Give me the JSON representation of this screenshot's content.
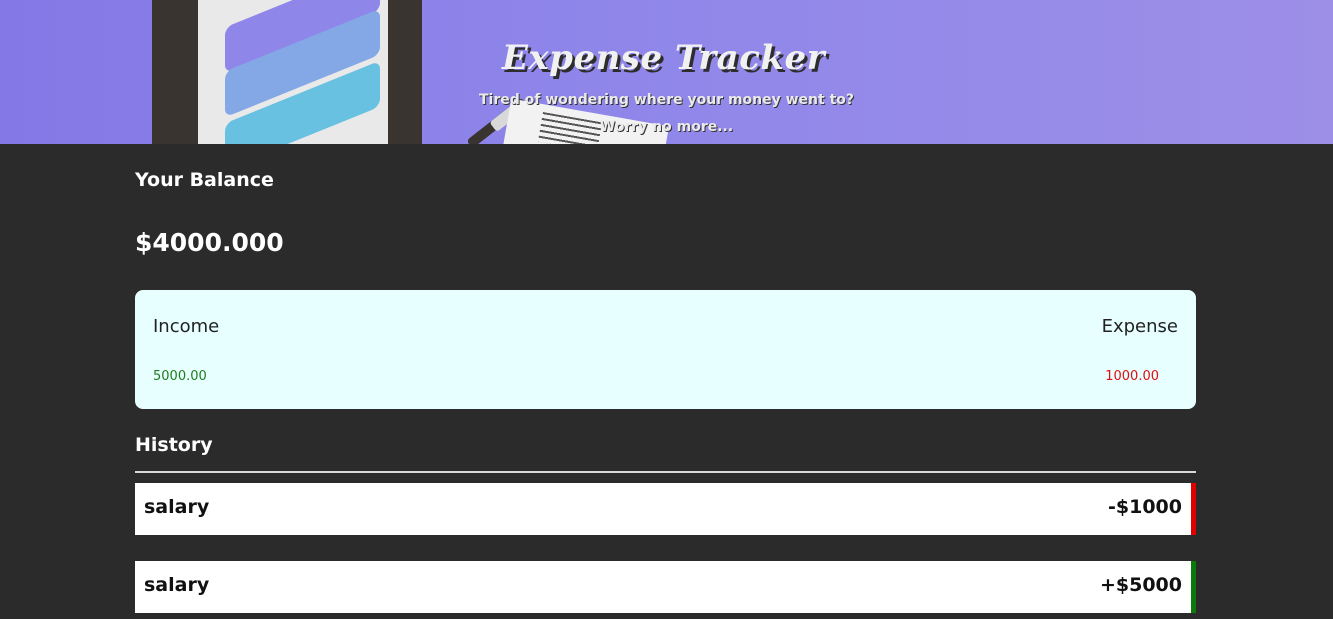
{
  "hero": {
    "title": "Expense Tracker",
    "subtitle_line1": "Tired of wondering where your money went to?",
    "subtitle_line2": "Worry no more..."
  },
  "balance": {
    "label": "Your Balance",
    "value": "$4000.000"
  },
  "summary": {
    "income_label": "Income",
    "income_value": "5000.00",
    "expense_label": "Expense",
    "expense_value": "1000.00"
  },
  "history": {
    "label": "History",
    "items": [
      {
        "name": "salary",
        "amount": "-$1000",
        "status_color": "#e00000"
      },
      {
        "name": "salary",
        "amount": "+$5000",
        "status_color": "#0a7a0a"
      }
    ]
  },
  "colors": {
    "hero_bg": "#8f86ea",
    "page_bg": "#2b2b2b",
    "summary_bg": "#e8ffff",
    "income": "#1e7d1e",
    "expense": "#e01010"
  }
}
